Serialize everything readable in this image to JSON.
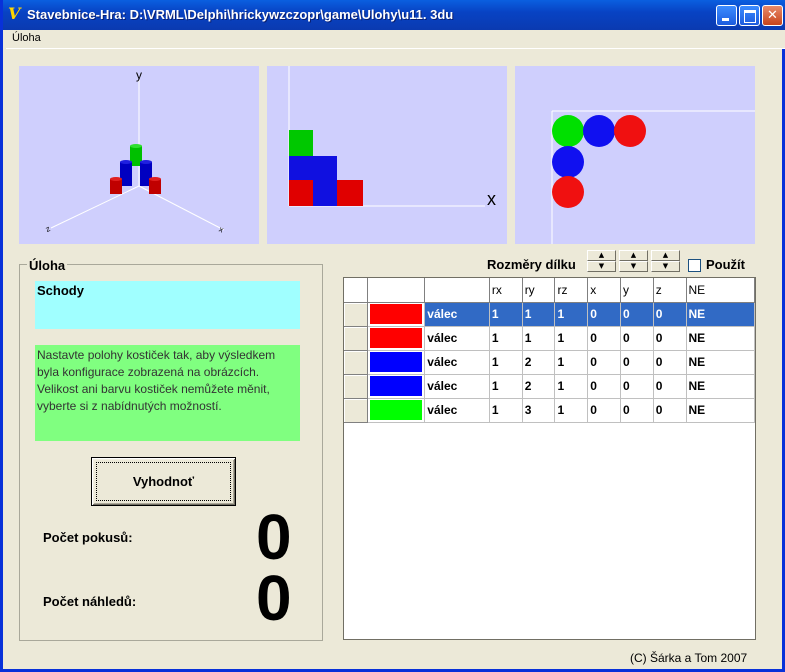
{
  "window": {
    "title": "Stavebnice-Hra: D:\\VRML\\Delphi\\hrickywzczopr\\game\\Ulohy\\u11. 3du",
    "icon": "app-logo-icon"
  },
  "menu": {
    "items": [
      "Úloha"
    ]
  },
  "views": {
    "axis_y": "y",
    "axis_x": "x",
    "colors": {
      "background": "#cfcffd",
      "red": "#ff1a1a",
      "blue": "#1a1aff",
      "green": "#00e000"
    }
  },
  "task": {
    "group_label": "Úloha",
    "name": "Schody",
    "description": "Nastavte polohy kostiček tak, aby výsledkem byla konfigurace zobrazená na obrázcích. Velikost ani barvu kostiček nemůžete měnit, vyberte si z nabídnutých možností.",
    "evaluate_button": "Vyhodnoť",
    "attempts_label": "Počet pokusů:",
    "attempts_value": "0",
    "previews_label": "Počet náhledů:",
    "previews_value": "0"
  },
  "dimensions": {
    "label": "Rozměry dílku",
    "use_label": "Použít",
    "use_checked": false
  },
  "grid": {
    "columns": [
      "",
      "",
      "",
      "rx",
      "ry",
      "rz",
      "x",
      "y",
      "z",
      "NE"
    ],
    "rows": [
      {
        "color": "#ff0000",
        "shape": "válec",
        "rx": "1",
        "ry": "1",
        "rz": "1",
        "x": "0",
        "y": "0",
        "z": "0",
        "ne": "NE",
        "selected": true
      },
      {
        "color": "#ff0000",
        "shape": "válec",
        "rx": "1",
        "ry": "1",
        "rz": "1",
        "x": "0",
        "y": "0",
        "z": "0",
        "ne": "NE",
        "selected": false
      },
      {
        "color": "#0000ff",
        "shape": "válec",
        "rx": "1",
        "ry": "2",
        "rz": "1",
        "x": "0",
        "y": "0",
        "z": "0",
        "ne": "NE",
        "selected": false
      },
      {
        "color": "#0000ff",
        "shape": "válec",
        "rx": "1",
        "ry": "2",
        "rz": "1",
        "x": "0",
        "y": "0",
        "z": "0",
        "ne": "NE",
        "selected": false
      },
      {
        "color": "#00ff00",
        "shape": "válec",
        "rx": "1",
        "ry": "3",
        "rz": "1",
        "x": "0",
        "y": "0",
        "z": "0",
        "ne": "NE",
        "selected": false
      }
    ]
  },
  "footer": {
    "copyright": "(C) Šárka a Tom 2007"
  }
}
